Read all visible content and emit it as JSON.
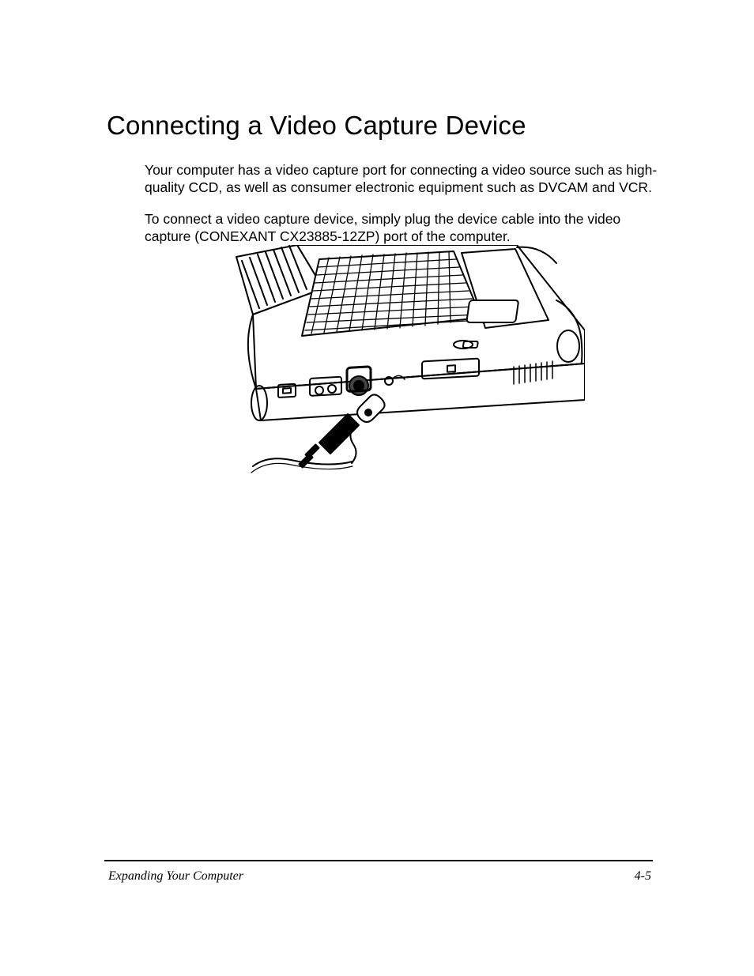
{
  "heading": "Connecting a Video Capture Device",
  "para1": "Your computer has a video capture port  for connecting a video source such as high-quality CCD, as well as consumer electronic equipment such as DVCAM and VCR.",
  "para2": "To connect a video capture device, simply plug the device cable into the video capture (CONEXANT CX23885-12ZP) port of the computer.",
  "footer_left": "Expanding Your Computer",
  "footer_right": "4-5"
}
